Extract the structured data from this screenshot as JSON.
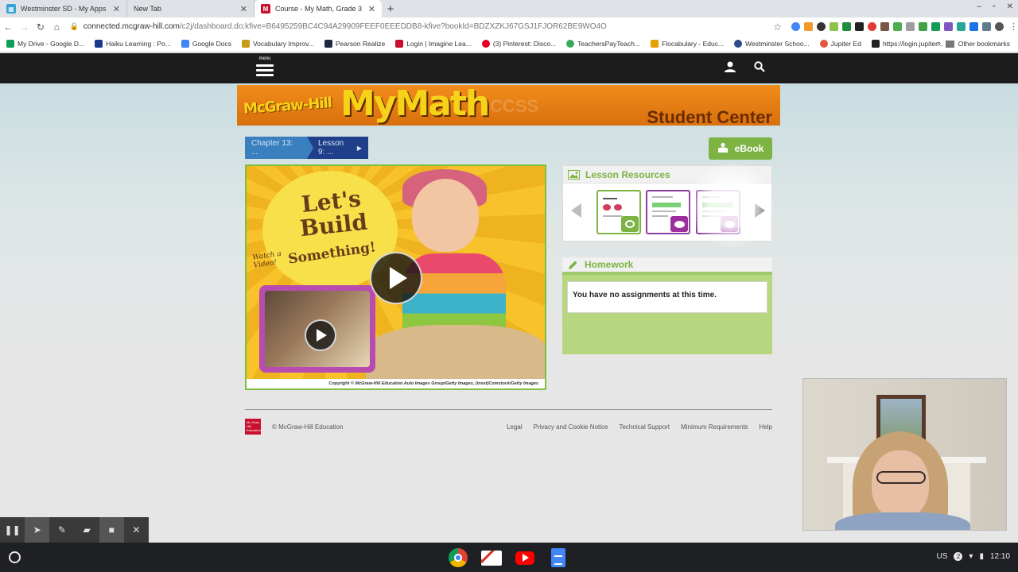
{
  "browser": {
    "tabs": [
      {
        "title": "Westminster SD - My Apps",
        "favicon_color": "#36a2da"
      },
      {
        "title": "New Tab",
        "favicon_color": "#dee1e6"
      },
      {
        "title": "Course - My Math, Grade 3",
        "favicon_color": "#c8102e",
        "favicon_glyph": "M",
        "active": true
      }
    ],
    "new_tab_symbol": "+",
    "window_controls": [
      "–",
      "▫",
      "✕"
    ],
    "url_host": "connected.mcgraw-hill.com",
    "url_path": "/c2j/dashboard.do;kfive=B6495259BC4C94A29909FEEF0EEEDDB8-kfive?bookId=BDZXZKJ67GSJ1FJOR62BE9WO4O",
    "bookmarks": [
      {
        "label": "My Drive - Google D...",
        "color": "#0f9d58"
      },
      {
        "label": "Haiku Learning : Po...",
        "color": "#1b3a8c"
      },
      {
        "label": "Google Docs",
        "color": "#4285f4"
      },
      {
        "label": "Vocabulary Improv...",
        "color": "#c89b16"
      },
      {
        "label": "Pearson Realize",
        "color": "#1e2a44"
      },
      {
        "label": "Login | Imagine Lea...",
        "color": "#c8102e"
      },
      {
        "label": "(3) Pinterest: Disco...",
        "color": "#e60023"
      },
      {
        "label": "TeachersPayTeach...",
        "color": "#3aaa5c"
      },
      {
        "label": "Flocabulary - Educ...",
        "color": "#e6a100"
      },
      {
        "label": "Westminster Schoo...",
        "color": "#2c4a8c"
      },
      {
        "label": "Jupiter Ed",
        "color": "#e0573c"
      },
      {
        "label": "https://login.jupiter...",
        "color": "#222222"
      }
    ],
    "bookmarks_more": "»",
    "other_bookmarks": "Other bookmarks"
  },
  "header": {
    "menu_label": "menu"
  },
  "banner": {
    "brand_small": "McGraw-Hill",
    "brand_my": "My",
    "brand_math": "Math",
    "ccss": "CCSS",
    "center_label": "Student Center"
  },
  "breadcrumb": {
    "chapter": "Chapter 13: ...",
    "lesson": "Lesson 9: ..."
  },
  "ebook_label": "eBook",
  "video": {
    "lets_build": "Let's Build",
    "something": "Something!",
    "watch_a_video": "Watch a Video!",
    "copyright": "Copyright © McGraw-Hill Education Auto Images Group/Getty Images, (inset)Comstock/Getty Images"
  },
  "lesson_resources": {
    "title": "Lesson Resources"
  },
  "homework": {
    "title": "Homework",
    "message": "You have no assignments at this time."
  },
  "footer": {
    "logo_text": "Mc Graw Hill Education",
    "copyright": "© McGraw-Hill Education",
    "links": [
      "Legal",
      "Privacy and Cookie Notice",
      "Technical Support",
      "Minimum Requirements",
      "Help"
    ]
  },
  "tray": {
    "locale": "US",
    "notifications": "2",
    "time": "12:10"
  },
  "colors": {
    "accent_green": "#7cb342",
    "breadcrumb_blue": "#3a80bf",
    "breadcrumb_navy": "#1f3f8a",
    "header_black": "#1c1c1c",
    "banner_orange": "#f08c1a"
  }
}
